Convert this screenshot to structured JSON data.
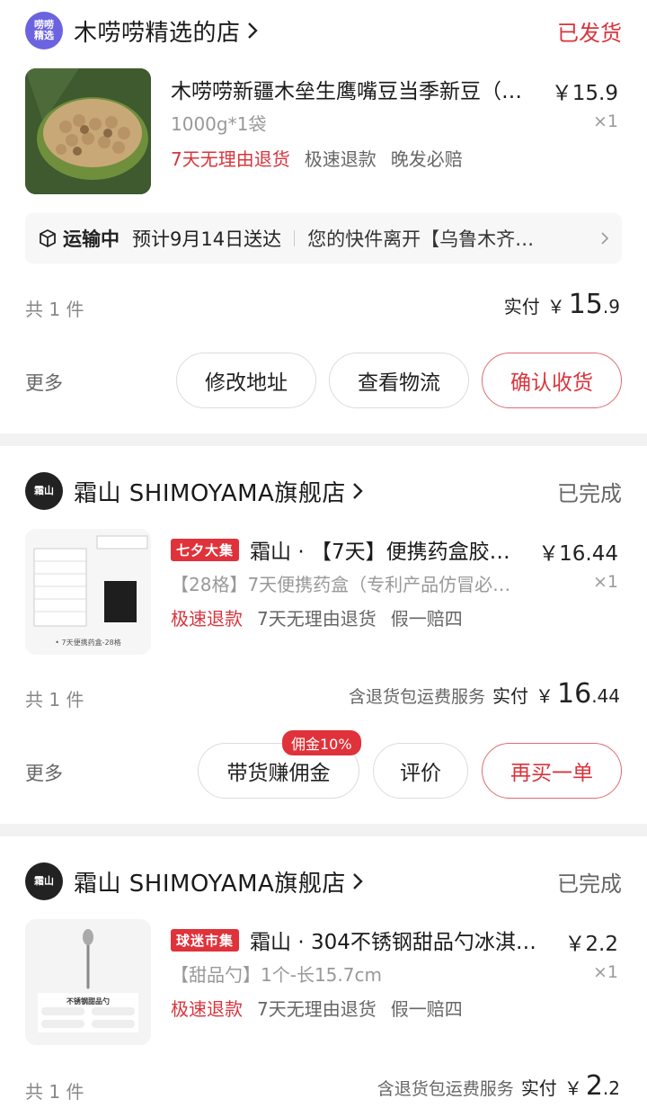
{
  "colors": {
    "accent": "#d9343c",
    "muted": "#999999",
    "background": "#f2f2f2"
  },
  "orders": [
    {
      "shop": {
        "logo_text": "唠唠精选",
        "name": "木唠唠精选的店",
        "icon": "chevron-right-icon"
      },
      "status": "已发货",
      "product": {
        "name": "木唠唠新疆木垒生鹰嘴豆当季新豆（…",
        "price": "￥15.9",
        "spec": "1000g*1袋",
        "qty": "×1",
        "tags": [
          "7天无理由退货",
          "极速退款",
          "晚发必赔"
        ]
      },
      "logistics": {
        "icon": "package-icon",
        "state": "运输中",
        "eta": "预计9月14日送达",
        "detail": "您的快件离开【乌鲁木齐…"
      },
      "count": "共 1 件",
      "paid": {
        "label": "实付",
        "currency": "￥",
        "int": "15",
        "dec": ".9"
      },
      "more": "更多",
      "buttons": [
        "修改地址",
        "查看物流",
        "确认收货"
      ]
    },
    {
      "shop": {
        "logo_text": "霜山",
        "name": "霜山 SHIMOYAMA旗舰店",
        "icon": "chevron-right-icon"
      },
      "status": "已完成",
      "product": {
        "badge": "七夕大集",
        "name": "霜山 · 【7天】便携药盒胶…",
        "price": "￥16.44",
        "spec": "【28格】7天便携药盒（专利产品仿冒必…",
        "qty": "×1",
        "tags": [
          "极速退款",
          "7天无理由退货",
          "假一赔四"
        ],
        "thumb_caption": "• 7天便携药盒-28格"
      },
      "count": "共 1 件",
      "paid": {
        "service": "含退货包运费服务",
        "label": "实付",
        "currency": "￥",
        "int": "16",
        "dec": ".44"
      },
      "more": "更多",
      "commission_bubble": "佣金10%",
      "buttons": [
        "带货赚佣金",
        "评价",
        "再买一单"
      ]
    },
    {
      "shop": {
        "logo_text": "霜山",
        "name": "霜山 SHIMOYAMA旗舰店",
        "icon": "chevron-right-icon"
      },
      "status": "已完成",
      "product": {
        "badge": "球迷市集",
        "name": "霜山 · 304不锈钢甜品勺冰淇…",
        "price": "￥2.2",
        "spec": "【甜品勺】1个-长15.7cm",
        "qty": "×1",
        "tags": [
          "极速退款",
          "7天无理由退货",
          "假一赔四"
        ],
        "thumb_caption": "不锈钢甜品勺"
      },
      "count": "共 1 件",
      "paid": {
        "service": "含退货包运费服务",
        "label": "实付",
        "currency": "￥",
        "int": "2",
        "dec": ".2"
      }
    }
  ]
}
